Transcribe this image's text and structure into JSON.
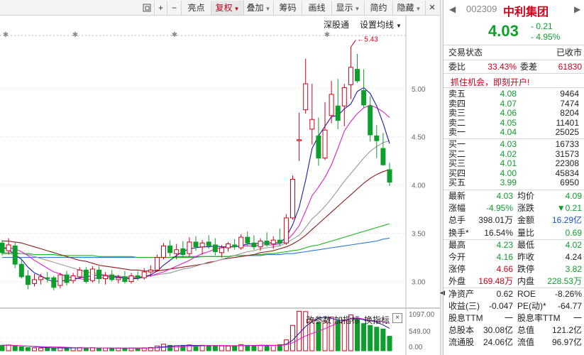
{
  "toolbar": {
    "buttons": [
      {
        "icon": "window-icon",
        "label": ""
      },
      {
        "icon": "plus-icon",
        "label": "+"
      },
      {
        "icon": "minus-icon",
        "label": "−"
      },
      {
        "label": "亮点"
      },
      {
        "label": "复权",
        "dropdown": true,
        "active": true
      },
      {
        "label": "叠加",
        "dropdown": true
      },
      {
        "label": "筹码"
      },
      {
        "label": "画线"
      },
      {
        "label": "显示",
        "dropdown": true
      },
      {
        "label": "简约"
      },
      {
        "label": "隐藏",
        "dropdown": true
      },
      {
        "icon": "close-icon",
        "label": "×"
      }
    ]
  },
  "chart": {
    "top_links": {
      "exchange": "深股通",
      "ma_settings": "设置均线"
    },
    "peak_label": "5.43",
    "price_ticks": [
      "5.00",
      "4.50",
      "4.00",
      "3.50",
      "3.00"
    ],
    "indicator_buttons": [
      "改参数",
      "加指标",
      "换指标"
    ],
    "volume_ticks": [
      "1097.00",
      "549.00",
      "0.00"
    ],
    "colors": {
      "up": "#d0021b",
      "down": "#0e9e2c",
      "ma5": "#1a1aa6",
      "ma10": "#e020c8",
      "ma20": "#999999",
      "ma30": "#8b1a1a",
      "ma60": "#1db51d",
      "ma120": "#2a7bd6"
    }
  },
  "chart_data": {
    "type": "candlestick",
    "ylim": [
      2.85,
      5.55
    ],
    "candles": [
      {
        "o": 3.4,
        "h": 3.43,
        "l": 3.27,
        "c": 3.3
      },
      {
        "o": 3.32,
        "h": 3.45,
        "l": 3.28,
        "c": 3.38
      },
      {
        "o": 3.37,
        "h": 3.41,
        "l": 3.14,
        "c": 3.18
      },
      {
        "o": 3.18,
        "h": 3.24,
        "l": 3.03,
        "c": 3.05
      },
      {
        "o": 3.06,
        "h": 3.12,
        "l": 2.92,
        "c": 2.97
      },
      {
        "o": 2.98,
        "h": 3.08,
        "l": 2.95,
        "c": 3.02
      },
      {
        "o": 3.02,
        "h": 3.08,
        "l": 2.97,
        "c": 3.05
      },
      {
        "o": 3.04,
        "h": 3.1,
        "l": 2.99,
        "c": 3.03
      },
      {
        "o": 3.04,
        "h": 3.06,
        "l": 2.91,
        "c": 2.94
      },
      {
        "o": 2.96,
        "h": 3.09,
        "l": 2.93,
        "c": 3.07
      },
      {
        "o": 3.07,
        "h": 3.11,
        "l": 2.96,
        "c": 2.99
      },
      {
        "o": 3.01,
        "h": 3.09,
        "l": 2.98,
        "c": 3.06
      },
      {
        "o": 3.05,
        "h": 3.15,
        "l": 3.03,
        "c": 3.12
      },
      {
        "o": 3.12,
        "h": 3.15,
        "l": 2.98,
        "c": 3.0
      },
      {
        "o": 3.01,
        "h": 3.16,
        "l": 2.99,
        "c": 3.13
      },
      {
        "o": 3.12,
        "h": 3.16,
        "l": 2.98,
        "c": 3.03
      },
      {
        "o": 3.03,
        "h": 3.1,
        "l": 2.97,
        "c": 3.06
      },
      {
        "o": 3.07,
        "h": 3.12,
        "l": 3.0,
        "c": 3.02
      },
      {
        "o": 3.02,
        "h": 3.07,
        "l": 2.98,
        "c": 3.04
      },
      {
        "o": 3.05,
        "h": 3.11,
        "l": 2.98,
        "c": 3.0
      },
      {
        "o": 3.0,
        "h": 3.09,
        "l": 2.98,
        "c": 3.06
      },
      {
        "o": 3.06,
        "h": 3.11,
        "l": 3.01,
        "c": 3.04
      },
      {
        "o": 3.04,
        "h": 3.14,
        "l": 3.02,
        "c": 3.1
      },
      {
        "o": 3.1,
        "h": 3.17,
        "l": 3.05,
        "c": 3.12
      },
      {
        "o": 3.12,
        "h": 3.28,
        "l": 3.1,
        "c": 3.25
      },
      {
        "o": 3.25,
        "h": 3.4,
        "l": 3.23,
        "c": 3.37
      },
      {
        "o": 3.37,
        "h": 3.43,
        "l": 3.26,
        "c": 3.3
      },
      {
        "o": 3.29,
        "h": 3.39,
        "l": 3.23,
        "c": 3.33
      },
      {
        "o": 3.34,
        "h": 3.42,
        "l": 3.25,
        "c": 3.28
      },
      {
        "o": 3.29,
        "h": 3.46,
        "l": 3.26,
        "c": 3.41
      },
      {
        "o": 3.41,
        "h": 3.47,
        "l": 3.32,
        "c": 3.36
      },
      {
        "o": 3.36,
        "h": 3.43,
        "l": 3.28,
        "c": 3.4
      },
      {
        "o": 3.41,
        "h": 3.48,
        "l": 3.34,
        "c": 3.37
      },
      {
        "o": 3.38,
        "h": 3.45,
        "l": 3.27,
        "c": 3.31
      },
      {
        "o": 3.3,
        "h": 3.38,
        "l": 3.25,
        "c": 3.35
      },
      {
        "o": 3.35,
        "h": 3.41,
        "l": 3.31,
        "c": 3.39
      },
      {
        "o": 3.38,
        "h": 3.44,
        "l": 3.33,
        "c": 3.36
      },
      {
        "o": 3.35,
        "h": 3.49,
        "l": 3.33,
        "c": 3.46
      },
      {
        "o": 3.46,
        "h": 3.52,
        "l": 3.37,
        "c": 3.4
      },
      {
        "o": 3.4,
        "h": 3.48,
        "l": 3.33,
        "c": 3.36
      },
      {
        "o": 3.36,
        "h": 3.45,
        "l": 3.32,
        "c": 3.42
      },
      {
        "o": 3.42,
        "h": 3.51,
        "l": 3.36,
        "c": 3.38
      },
      {
        "o": 3.39,
        "h": 3.47,
        "l": 3.34,
        "c": 3.43
      },
      {
        "o": 3.43,
        "h": 3.55,
        "l": 3.37,
        "c": 3.4
      },
      {
        "o": 3.4,
        "h": 3.7,
        "l": 3.38,
        "c": 3.66
      },
      {
        "o": 3.66,
        "h": 4.1,
        "l": 3.64,
        "c": 4.06
      },
      {
        "o": 4.46,
        "h": 4.75,
        "l": 4.25,
        "c": 4.47
      },
      {
        "o": 4.78,
        "h": 5.31,
        "l": 4.74,
        "c": 5.05
      },
      {
        "o": 4.58,
        "h": 5.05,
        "l": 4.42,
        "c": 4.68
      },
      {
        "o": 4.51,
        "h": 4.7,
        "l": 4.2,
        "c": 4.28
      },
      {
        "o": 4.28,
        "h": 4.86,
        "l": 4.26,
        "c": 4.57
      },
      {
        "o": 4.72,
        "h": 5.08,
        "l": 4.64,
        "c": 4.94
      },
      {
        "o": 4.82,
        "h": 5.1,
        "l": 4.58,
        "c": 4.67
      },
      {
        "o": 4.82,
        "h": 5.05,
        "l": 4.61,
        "c": 5.01
      },
      {
        "o": 5.04,
        "h": 5.43,
        "l": 4.89,
        "c": 5.22
      },
      {
        "o": 5.2,
        "h": 5.36,
        "l": 5.06,
        "c": 5.08
      },
      {
        "o": 4.98,
        "h": 5.2,
        "l": 4.8,
        "c": 4.83
      },
      {
        "o": 4.82,
        "h": 4.92,
        "l": 4.45,
        "c": 4.52
      },
      {
        "o": 4.51,
        "h": 4.62,
        "l": 4.28,
        "c": 4.46
      },
      {
        "o": 4.38,
        "h": 4.54,
        "l": 4.2,
        "c": 4.21
      },
      {
        "o": 4.16,
        "h": 4.23,
        "l": 3.99,
        "c": 4.03
      }
    ],
    "ma5": [
      3.36,
      3.33,
      3.28,
      3.23,
      3.15,
      3.09,
      3.06,
      3.02,
      3.0,
      3.01,
      3.01,
      3.02,
      3.04,
      3.05,
      3.06,
      3.07,
      3.06,
      3.05,
      3.05,
      3.03,
      3.03,
      3.03,
      3.05,
      3.07,
      3.11,
      3.17,
      3.22,
      3.27,
      3.31,
      3.34,
      3.35,
      3.36,
      3.36,
      3.37,
      3.36,
      3.36,
      3.36,
      3.37,
      3.39,
      3.39,
      3.4,
      3.4,
      3.4,
      3.4,
      3.46,
      3.59,
      3.77,
      4.05,
      4.38,
      4.51,
      4.61,
      4.71,
      4.72,
      4.79,
      4.84,
      4.97,
      5.01,
      4.95,
      4.82,
      4.64,
      4.43
    ],
    "ma10": [
      3.35,
      3.35,
      3.34,
      3.31,
      3.27,
      3.22,
      3.18,
      3.14,
      3.1,
      3.08,
      3.05,
      3.04,
      3.03,
      3.02,
      3.03,
      3.04,
      3.04,
      3.04,
      3.05,
      3.04,
      3.04,
      3.04,
      3.05,
      3.06,
      3.08,
      3.1,
      3.13,
      3.16,
      3.19,
      3.22,
      3.26,
      3.29,
      3.31,
      3.34,
      3.35,
      3.36,
      3.36,
      3.37,
      3.37,
      3.37,
      3.38,
      3.38,
      3.38,
      3.39,
      3.42,
      3.49,
      3.58,
      3.73,
      3.89,
      3.98,
      4.08,
      4.21,
      4.38,
      4.56,
      4.66,
      4.74,
      4.8,
      4.83,
      4.8,
      4.76,
      4.7
    ],
    "ma20": [
      3.3,
      3.3,
      3.3,
      3.29,
      3.28,
      3.26,
      3.24,
      3.22,
      3.2,
      3.18,
      3.16,
      3.14,
      3.12,
      3.1,
      3.09,
      3.08,
      3.07,
      3.06,
      3.06,
      3.05,
      3.05,
      3.05,
      3.05,
      3.06,
      3.07,
      3.08,
      3.09,
      3.11,
      3.13,
      3.14,
      3.16,
      3.18,
      3.19,
      3.21,
      3.23,
      3.25,
      3.27,
      3.29,
      3.31,
      3.32,
      3.34,
      3.35,
      3.36,
      3.37,
      3.4,
      3.44,
      3.48,
      3.56,
      3.65,
      3.71,
      3.78,
      3.86,
      3.95,
      4.04,
      4.12,
      4.2,
      4.28,
      4.35,
      4.4,
      4.44,
      4.46
    ],
    "ma30": [
      3.42,
      3.42,
      3.41,
      3.4,
      3.38,
      3.36,
      3.34,
      3.32,
      3.3,
      3.28,
      3.26,
      3.24,
      3.22,
      3.21,
      3.19,
      3.17,
      3.16,
      3.15,
      3.14,
      3.13,
      3.12,
      3.12,
      3.11,
      3.11,
      3.11,
      3.12,
      3.13,
      3.14,
      3.15,
      3.16,
      3.17,
      3.18,
      3.2,
      3.21,
      3.23,
      3.24,
      3.25,
      3.26,
      3.27,
      3.28,
      3.3,
      3.31,
      3.32,
      3.34,
      3.36,
      3.39,
      3.43,
      3.48,
      3.54,
      3.6,
      3.66,
      3.72,
      3.78,
      3.84,
      3.9,
      3.96,
      4.02,
      4.07,
      4.11,
      4.14,
      4.16
    ],
    "ma60": [
      3.29,
      3.29,
      3.29,
      3.29,
      3.29,
      3.28,
      3.28,
      3.28,
      3.28,
      3.27,
      3.27,
      3.27,
      3.27,
      3.27,
      3.27,
      3.26,
      3.26,
      3.26,
      3.26,
      3.26,
      3.26,
      3.25,
      3.25,
      3.25,
      3.25,
      3.25,
      3.25,
      3.25,
      3.25,
      3.25,
      3.25,
      3.26,
      3.26,
      3.26,
      3.26,
      3.26,
      3.27,
      3.27,
      3.27,
      3.28,
      3.28,
      3.29,
      3.29,
      3.3,
      3.31,
      3.32,
      3.33,
      3.35,
      3.37,
      3.38,
      3.4,
      3.42,
      3.44,
      3.46,
      3.48,
      3.5,
      3.52,
      3.54,
      3.56,
      3.58,
      3.6
    ],
    "ma120": [
      3.25,
      3.25,
      3.25,
      3.25,
      3.25,
      3.25,
      3.25,
      3.25,
      3.25,
      3.25,
      3.25,
      3.25,
      3.25,
      3.25,
      3.25,
      3.25,
      3.25,
      3.25,
      3.25,
      3.25,
      3.25,
      3.25,
      3.25,
      3.25,
      3.25,
      3.25,
      3.25,
      3.26,
      3.26,
      3.26,
      3.26,
      3.26,
      3.26,
      3.26,
      3.26,
      3.26,
      3.27,
      3.27,
      3.27,
      3.27,
      3.27,
      3.28,
      3.28,
      3.28,
      3.29,
      3.29,
      3.3,
      3.31,
      3.32,
      3.33,
      3.34,
      3.35,
      3.36,
      3.37,
      3.38,
      3.39,
      3.4,
      3.41,
      3.42,
      3.44,
      3.45
    ],
    "volume": [
      150,
      160,
      130,
      110,
      90,
      80,
      75,
      80,
      70,
      85,
      75,
      80,
      90,
      70,
      85,
      70,
      75,
      70,
      72,
      70,
      75,
      72,
      80,
      90,
      130,
      180,
      150,
      140,
      130,
      160,
      140,
      150,
      140,
      130,
      135,
      130,
      140,
      170,
      150,
      140,
      150,
      145,
      150,
      170,
      300,
      700,
      1090,
      1080,
      860,
      780,
      820,
      930,
      820,
      850,
      990,
      860,
      750,
      700,
      650,
      600,
      400
    ],
    "volume_ylim": [
      0,
      1097
    ]
  },
  "panel": {
    "code": "002309",
    "name": "中利集团",
    "price": "4.03",
    "change": "- 0.21",
    "change_pct": "- 4.95%",
    "status_label": "交易状态",
    "status_value": "已收市",
    "wei_bi_label": "委比",
    "wei_bi_value": "33.43%",
    "wei_cha_label": "委差",
    "wei_cha_value": "61830",
    "promo": "抓住机会，即刻开户!",
    "asks": [
      {
        "name": "卖五",
        "price": "4.08",
        "vol": "9464"
      },
      {
        "name": "卖四",
        "price": "4.07",
        "vol": "7474"
      },
      {
        "name": "卖三",
        "price": "4.06",
        "vol": "8204"
      },
      {
        "name": "卖二",
        "price": "4.05",
        "vol": "11401"
      },
      {
        "name": "卖一",
        "price": "4.04",
        "vol": "25025"
      }
    ],
    "bids": [
      {
        "name": "买一",
        "price": "4.03",
        "vol": "16733"
      },
      {
        "name": "买二",
        "price": "4.02",
        "vol": "31573"
      },
      {
        "name": "买三",
        "price": "4.01",
        "vol": "22308"
      },
      {
        "name": "买四",
        "price": "4.00",
        "vol": "45834"
      },
      {
        "name": "买五",
        "price": "3.99",
        "vol": "6950"
      }
    ],
    "stats": [
      {
        "l1": "最新",
        "v1": "4.03",
        "c1": "green",
        "l2": "均价",
        "v2": "4.09",
        "c2": "green"
      },
      {
        "l1": "涨幅",
        "v1": "-4.95%",
        "c1": "green",
        "l2": "涨跌",
        "v2": "▼0.21",
        "c2": "green"
      },
      {
        "l1": "总手",
        "v1": "398.01万",
        "c1": "",
        "l2": "金额",
        "v2": "16.29亿",
        "c2": "blue"
      },
      {
        "l1": "换手*",
        "v1": "16.54%",
        "c1": "",
        "l2": "量比",
        "v2": "0.69",
        "c2": "green"
      },
      {
        "l1": "最高",
        "v1": "4.23",
        "c1": "green",
        "l2": "最低",
        "v2": "4.02",
        "c2": "green"
      },
      {
        "l1": "今开",
        "v1": "4.16",
        "c1": "green",
        "l2": "昨收",
        "v2": "4.24",
        "c2": ""
      },
      {
        "l1": "涨停",
        "v1": "4.66",
        "c1": "red",
        "l2": "跌停",
        "v2": "3.82",
        "c2": "green"
      },
      {
        "l1": "外盘",
        "v1": "169.48万",
        "c1": "red",
        "l2": "内盘",
        "v2": "228.53万",
        "c2": "green"
      },
      {
        "l1": "净资产",
        "v1": "0.62",
        "c1": "",
        "l2": "ROE",
        "v2": "-8.26%",
        "c2": ""
      },
      {
        "l1": "收益(三)",
        "v1": "-0.047",
        "c1": "",
        "l2": "PE(动)*",
        "v2": "-64.77",
        "c2": ""
      },
      {
        "l1": "股息TTM",
        "v1": "一",
        "c1": "",
        "l2": "股息率TTM",
        "v2": "一",
        "c2": ""
      },
      {
        "l1": "总股本",
        "v1": "30.08亿",
        "c1": "",
        "l2": "总值",
        "v2": "121.2亿",
        "c2": ""
      },
      {
        "l1": "流通股",
        "v1": "24.06亿",
        "c1": "",
        "l2": "流值",
        "v2": "96.97亿",
        "c2": ""
      }
    ]
  }
}
